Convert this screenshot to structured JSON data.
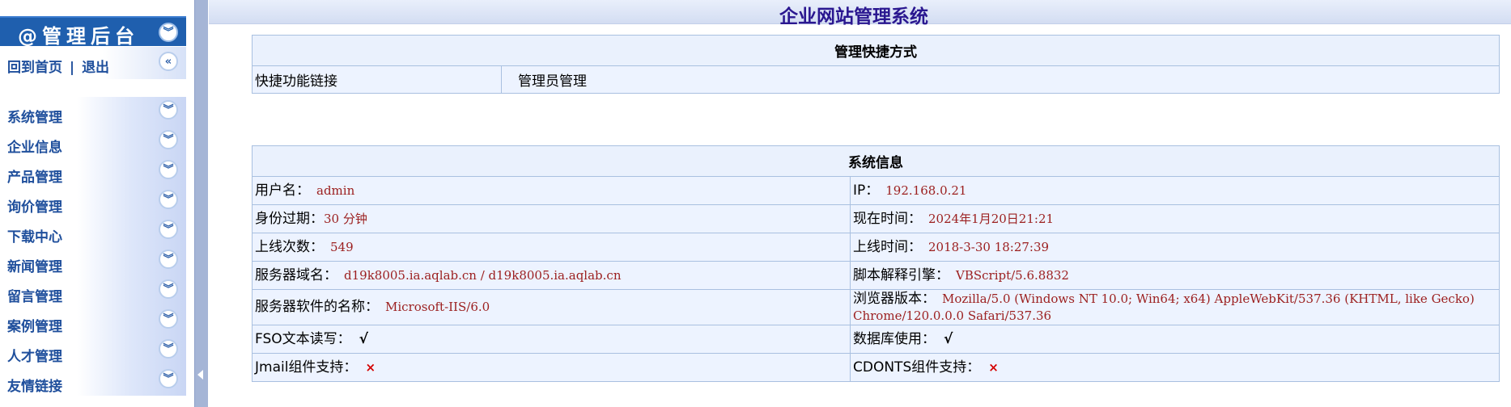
{
  "sidebar": {
    "title": "@管理后台",
    "home_link": "回到首页",
    "separator": "|",
    "logout_link": "退出",
    "menu": [
      {
        "label": "系统管理"
      },
      {
        "label": "企业信息"
      },
      {
        "label": "产品管理"
      },
      {
        "label": "询价管理"
      },
      {
        "label": "下载中心"
      },
      {
        "label": "新闻管理"
      },
      {
        "label": "留言管理"
      },
      {
        "label": "案例管理"
      },
      {
        "label": "人才管理"
      },
      {
        "label": "友情链接"
      }
    ],
    "chevron_down_glyph": "︾",
    "chevron_left_glyph": "«"
  },
  "header": {
    "title": "企业网站管理系统"
  },
  "quick_links": {
    "heading": "管理快捷方式",
    "label": "快捷功能链接",
    "link": "管理员管理"
  },
  "system_info": {
    "heading": "系统信息",
    "username_label": "用户名：",
    "username": "admin",
    "ip_label": "IP：",
    "ip": "192.168.0.21",
    "expire_label": "身份过期：",
    "expire": "30 分钟",
    "now_label": "现在时间：",
    "now": "2024年1月20日21:21",
    "login_count_label": "上线次数：",
    "login_count": "549",
    "login_time_label": "上线时间：",
    "login_time": "2018-3-30 18:27:39",
    "domain_label": "服务器域名：",
    "domain": "d19k8005.ia.aqlab.cn / d19k8005.ia.aqlab.cn",
    "script_label": "脚本解释引擎：",
    "script": "VBScript/5.6.8832",
    "server_sw_label": "服务器软件的名称：",
    "server_sw": "Microsoft-IIS/6.0",
    "browser_label": "浏览器版本：",
    "browser": "Mozilla/5.0 (Windows NT 10.0; Win64; x64) AppleWebKit/537.36 (KHTML, like Gecko) Chrome/120.0.0.0 Safari/537.36",
    "fso_label": "FSO文本读写：",
    "fso": "√",
    "db_label": "数据库使用：",
    "db": "√",
    "jmail_label": "Jmail组件支持：",
    "jmail": "×",
    "cdonts_label": "CDONTS组件支持：",
    "cdonts": "×"
  },
  "colors": {
    "brand_blue": "#1f5fae",
    "title_purple": "#2a1790",
    "value_red": "#9c2020",
    "cross_red": "#d40000"
  }
}
